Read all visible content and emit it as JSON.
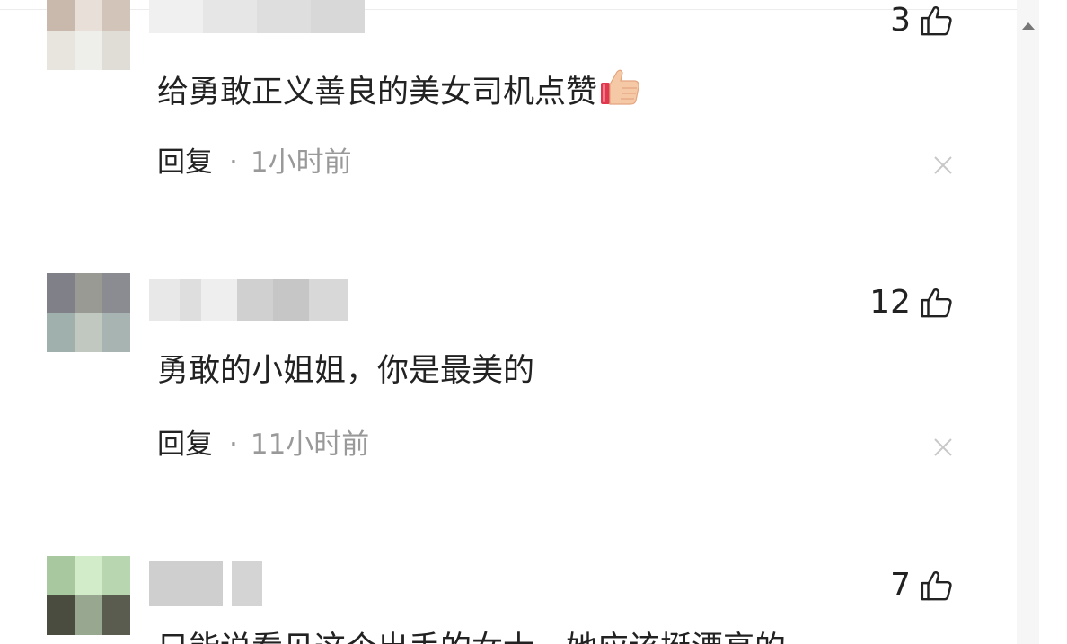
{
  "comments": [
    {
      "like_count": "3",
      "text": "给勇敢正义善良的美女司机点赞",
      "emoji_icon": "thumbs-up-emoji",
      "reply_label": "回复",
      "separator": "·",
      "time": "1小时前"
    },
    {
      "like_count": "12",
      "text": "勇敢的小姐姐，你是最美的",
      "reply_label": "回复",
      "separator": "·",
      "time": "11小时前"
    },
    {
      "like_count": "7",
      "text": "只能说看见这个出手的女士，她应该挺漂亮的"
    }
  ],
  "icons": {
    "like": "thumbs-up-outline-icon",
    "close": "close-icon",
    "scroll_up": "scroll-up-arrow-icon"
  },
  "colors": {
    "text": "#222222",
    "meta": "#999999",
    "scroll_track": "#f6f6f6"
  }
}
